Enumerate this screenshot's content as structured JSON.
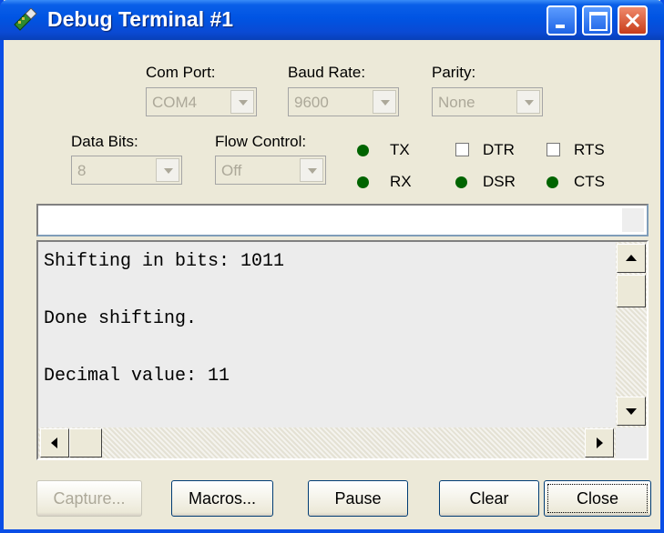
{
  "window": {
    "title": "Debug Terminal #1"
  },
  "settings": {
    "com_port": {
      "label": "Com Port:",
      "value": "COM4"
    },
    "baud_rate": {
      "label": "Baud Rate:",
      "value": "9600"
    },
    "parity": {
      "label": "Parity:",
      "value": "None"
    },
    "data_bits": {
      "label": "Data Bits:",
      "value": "8"
    },
    "flow_control": {
      "label": "Flow Control:",
      "value": "Off"
    }
  },
  "indicators": {
    "tx": "TX",
    "rx": "RX",
    "dsr": "DSR",
    "cts": "CTS",
    "led_color": "#006400"
  },
  "checkboxes": {
    "dtr": "DTR",
    "rts": "RTS"
  },
  "output": {
    "lines": [
      "Shifting in bits: 1011",
      "",
      "Done shifting.",
      "",
      "Decimal value: 11"
    ]
  },
  "buttons": {
    "capture": "Capture...",
    "macros": "Macros...",
    "pause": "Pause",
    "clear": "Clear",
    "close": "Close"
  },
  "colors": {
    "title_bar": "#0054e3",
    "window_bg": "#ece9d8",
    "close_button": "#c83c1a"
  }
}
